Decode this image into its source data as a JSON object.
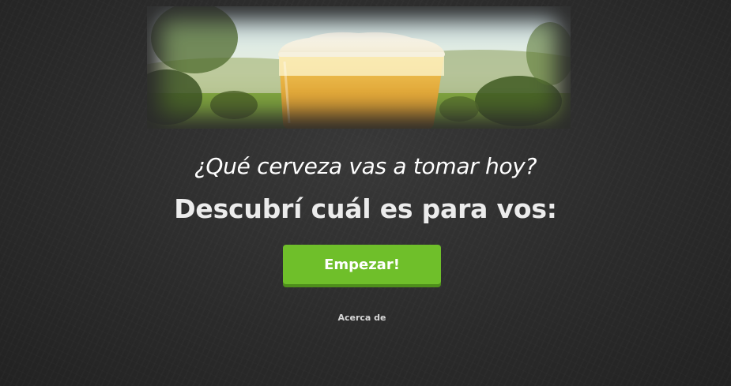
{
  "hero": {
    "image": "beer-glass-over-green-landscape"
  },
  "headline": {
    "question": "¿Qué cerveza vas a tomar hoy?",
    "subtitle": "Descubrí cuál es para vos:"
  },
  "actions": {
    "start_label": "Empezar!",
    "about_label": "Acerca de"
  },
  "colors": {
    "background": "#2b2b2b",
    "button": "#6fbf2a",
    "button_shadow": "#4e8e1b",
    "text": "#ffffff"
  }
}
